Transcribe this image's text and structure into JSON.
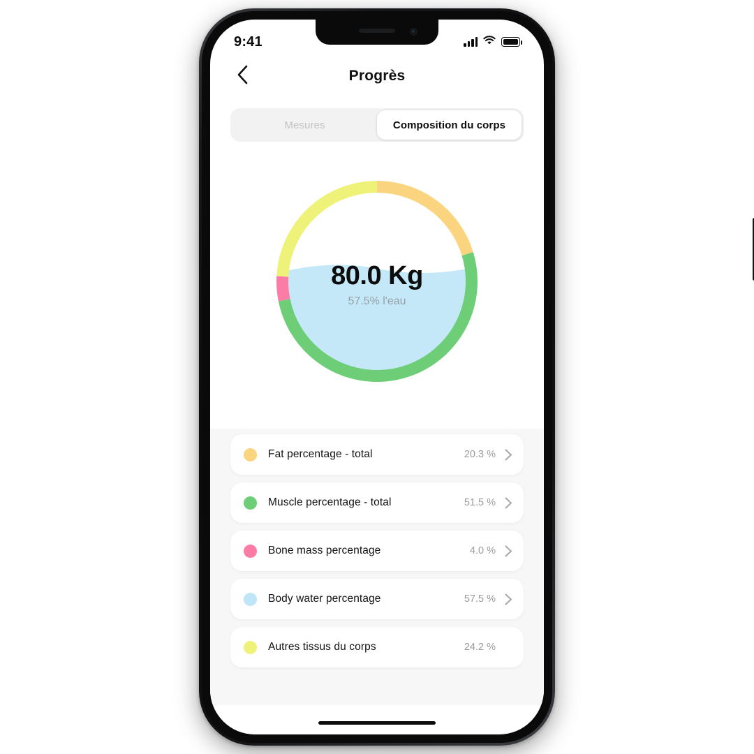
{
  "status_bar": {
    "time": "9:41",
    "cellular_icon": "signal-bars-icon",
    "wifi_icon": "wifi-icon",
    "battery_icon": "battery-full-icon"
  },
  "nav": {
    "back_icon": "chevron-left-icon",
    "title": "Progrès"
  },
  "segmented_control": {
    "options": [
      {
        "label": "Mesures",
        "active": false
      },
      {
        "label": "Composition du corps",
        "active": true
      }
    ]
  },
  "donut": {
    "weight": "80.0 Kg",
    "subtitle": "57.5% l'eau",
    "water_fill_pct": 57.5,
    "water_color": "#c4e8f7"
  },
  "colors": {
    "fat": "#fbd47f",
    "muscle": "#6ece77",
    "bone": "#fb7da6",
    "water": "#bfe5f8",
    "other": "#eff279",
    "value_text": "#9b9b9b",
    "muted_text": "#c3c3c3"
  },
  "metrics": [
    {
      "label": "Fat percentage - total",
      "value": "20.3 %",
      "color": "#fbd47f",
      "chevron": true,
      "chevron_icon": "chevron-right-icon"
    },
    {
      "label": "Muscle percentage - total",
      "value": "51.5 %",
      "color": "#6ece77",
      "chevron": true,
      "chevron_icon": "chevron-right-icon"
    },
    {
      "label": "Bone mass percentage",
      "value": "4.0 %",
      "color": "#fb7da6",
      "chevron": true,
      "chevron_icon": "chevron-right-icon"
    },
    {
      "label": "Body water percentage",
      "value": "57.5 %",
      "color": "#bfe5f8",
      "chevron": true,
      "chevron_icon": "chevron-right-icon"
    },
    {
      "label": "Autres tissus du corps",
      "value": "24.2 %",
      "color": "#eff279",
      "chevron": false,
      "chevron_icon": "chevron-right-icon"
    }
  ],
  "chart_data": {
    "type": "pie",
    "title": "Composition du corps",
    "center_label": "80.0 Kg",
    "center_sublabel": "57.5% l'eau",
    "unit": "%",
    "start_angle_deg": 0,
    "direction": "clockwise",
    "categories": [
      "Fat percentage - total",
      "Muscle percentage - total",
      "Bone mass percentage",
      "Autres tissus du corps"
    ],
    "values": [
      20.3,
      51.5,
      4.0,
      24.2
    ],
    "colors": [
      "#fbd47f",
      "#6ece77",
      "#fb7da6",
      "#eff279"
    ],
    "inner_fill": {
      "name": "Body water percentage",
      "value": 57.5,
      "color": "#c4e8f7"
    },
    "legend_position": "below-as-list"
  }
}
